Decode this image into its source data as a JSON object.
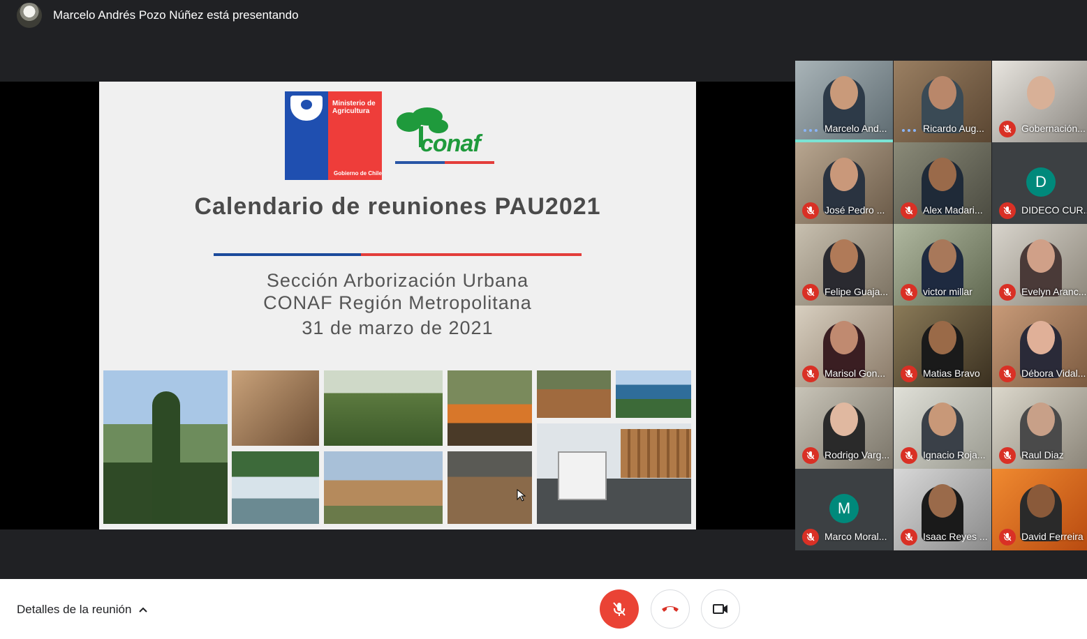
{
  "presenter": {
    "label": "Marcelo Andrés Pozo Núñez está presentando"
  },
  "slide": {
    "ministry_line1": "Ministerio de",
    "ministry_line2": "Agricultura",
    "gobierno": "Gobierno de Chile",
    "conaf": "conaf",
    "title": "Calendario de reuniones PAU2021",
    "subtitle1": "Sección Arborización Urbana",
    "subtitle2": "CONAF Región Metropolitana",
    "date": "31 de marzo de 2021"
  },
  "participants": [
    {
      "name": "Marcelo And...",
      "muted": false
    },
    {
      "name": "Ricardo Aug...",
      "muted": false
    },
    {
      "name": "Gobernación...",
      "muted": true
    },
    {
      "name": "José Pedro ...",
      "muted": true
    },
    {
      "name": "Alex Madari...",
      "muted": true
    },
    {
      "name": "DIDECO CUR...",
      "muted": true,
      "initial": "D"
    },
    {
      "name": "Felipe Guaja...",
      "muted": true
    },
    {
      "name": "victor millar",
      "muted": true
    },
    {
      "name": "Evelyn Aranc...",
      "muted": true
    },
    {
      "name": "Marisol Gon...",
      "muted": true
    },
    {
      "name": "Matias Bravo",
      "muted": true
    },
    {
      "name": "Débora Vidal...",
      "muted": true
    },
    {
      "name": "Rodrigo Varg...",
      "muted": true
    },
    {
      "name": "Ignacio Roja...",
      "muted": true
    },
    {
      "name": "Raul Diaz",
      "muted": true
    },
    {
      "name": "Marco Moral...",
      "muted": true,
      "initial": "M"
    },
    {
      "name": "Isaac Reyes ...",
      "muted": true
    },
    {
      "name": "David Ferreira",
      "muted": true
    }
  ],
  "bottom": {
    "details": "Detalles de la reunión"
  },
  "colors": {
    "accent_red": "#ea4335",
    "muted_red": "#d93025",
    "avatar_teal": "#00897b",
    "active_bar": "#7be3d4"
  }
}
